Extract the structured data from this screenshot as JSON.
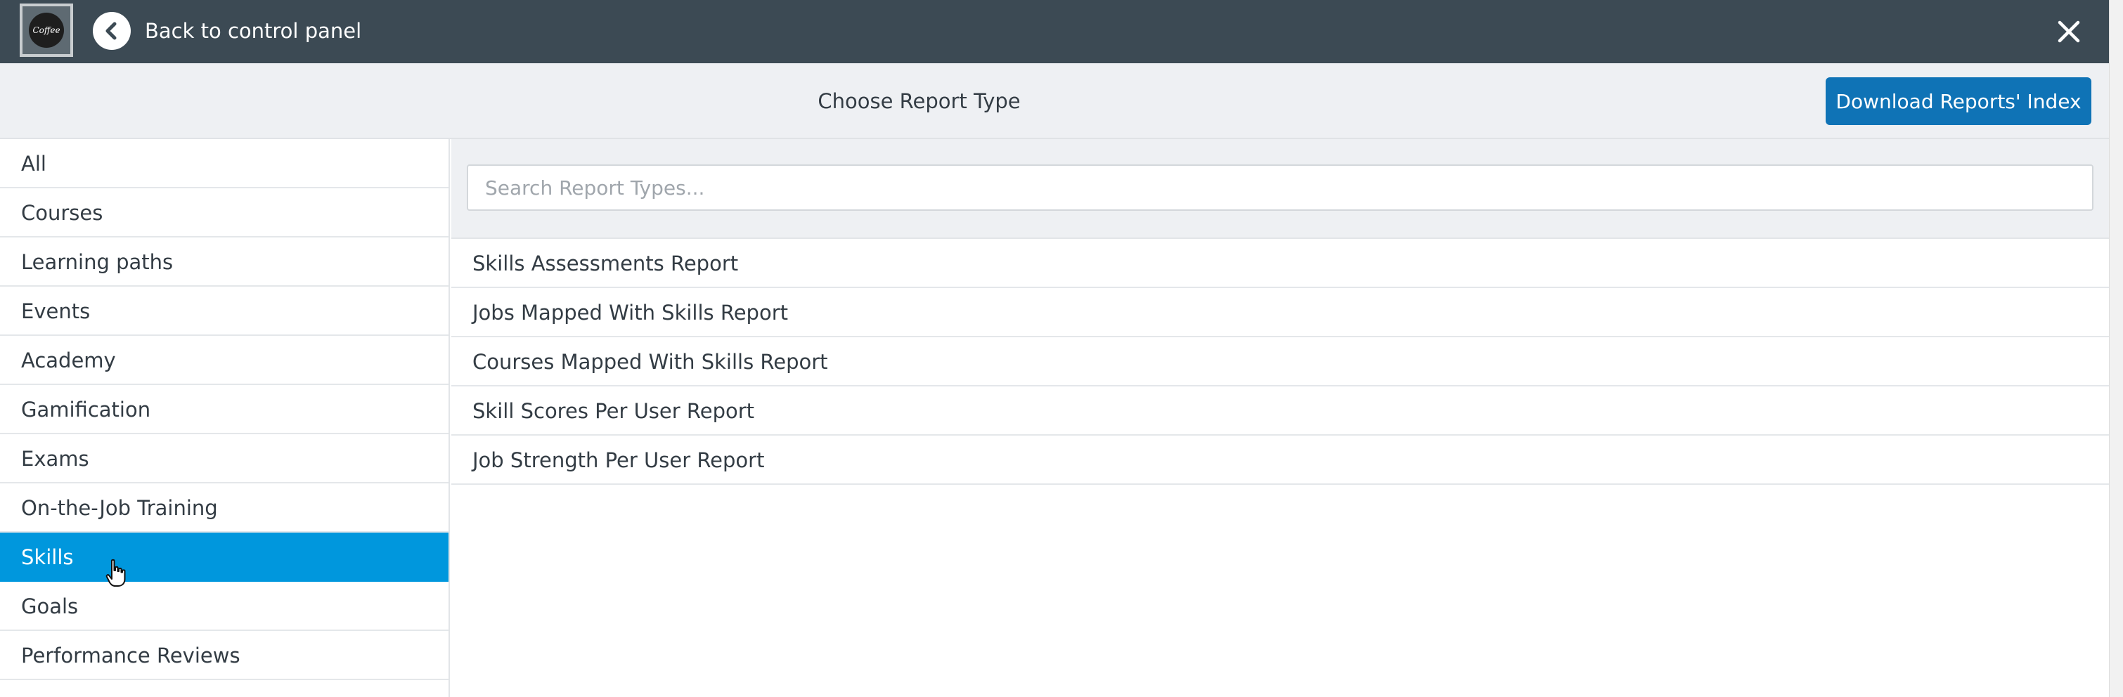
{
  "header": {
    "logo_icon": "coffee-logo",
    "logo_text": "Coffee",
    "back_icon": "chevron-left-circle-icon",
    "back_label": "Back to control panel",
    "close_icon": "close-icon",
    "background_color": "#3c4a54"
  },
  "subheader": {
    "title": "Choose Report Type",
    "download_button_label": "Download Reports' Index"
  },
  "search": {
    "placeholder": "Search Report Types...",
    "value": ""
  },
  "categories": [
    {
      "label": "All",
      "active": false
    },
    {
      "label": "Courses",
      "active": false
    },
    {
      "label": "Learning paths",
      "active": false
    },
    {
      "label": "Events",
      "active": false
    },
    {
      "label": "Academy",
      "active": false
    },
    {
      "label": "Gamification",
      "active": false
    },
    {
      "label": "Exams",
      "active": false
    },
    {
      "label": "On-the-Job Training",
      "active": false
    },
    {
      "label": "Skills",
      "active": true
    },
    {
      "label": "Goals",
      "active": false
    },
    {
      "label": "Performance Reviews",
      "active": false
    }
  ],
  "reports": [
    {
      "label": "Skills Assessments Report"
    },
    {
      "label": "Jobs Mapped With Skills Report"
    },
    {
      "label": "Courses Mapped With Skills Report"
    },
    {
      "label": "Skill Scores Per User Report"
    },
    {
      "label": "Job Strength Per User Report"
    }
  ],
  "colors": {
    "accent_active": "#0097dd",
    "button_primary": "#0f73b6",
    "panel_background": "#eef0f3",
    "text": "#333c44"
  }
}
